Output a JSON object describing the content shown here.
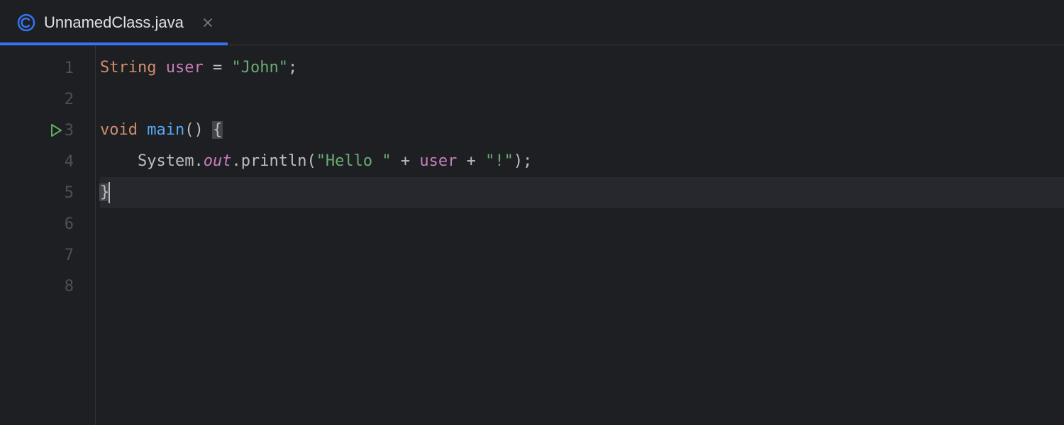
{
  "tab": {
    "filename": "UnnamedClass.java",
    "active": true
  },
  "gutter": {
    "lines": [
      "1",
      "2",
      "3",
      "4",
      "5",
      "6",
      "7",
      "8"
    ],
    "run_marker_line": 3
  },
  "code": {
    "line1": {
      "type_kw": "String",
      "var": "user",
      "eq": " = ",
      "str": "\"John\"",
      "semi": ";"
    },
    "line3": {
      "void_kw": "void",
      "method": "main",
      "parens": "()",
      "brace": "{"
    },
    "line4": {
      "indent": "    ",
      "class": "System",
      "dot1": ".",
      "out": "out",
      "dot2": ".",
      "println": "println",
      "lparen": "(",
      "str1": "\"Hello \"",
      "plus1": " + ",
      "user": "user",
      "plus2": " + ",
      "str2": "\"!\"",
      "rparen": ")",
      "semi": ";"
    },
    "line5": {
      "brace": "}"
    }
  }
}
